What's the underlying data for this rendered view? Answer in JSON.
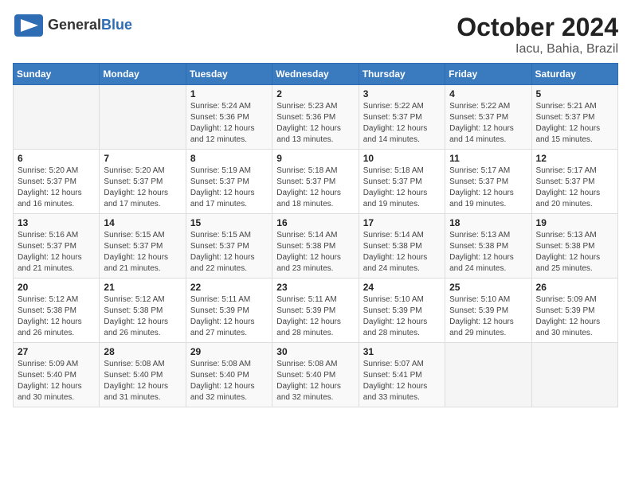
{
  "header": {
    "logo": {
      "general": "General",
      "blue": "Blue",
      "icon": "▶"
    },
    "title": "October 2024",
    "subtitle": "Iacu, Bahia, Brazil"
  },
  "calendar": {
    "days_of_week": [
      "Sunday",
      "Monday",
      "Tuesday",
      "Wednesday",
      "Thursday",
      "Friday",
      "Saturday"
    ],
    "weeks": [
      [
        {
          "day": "",
          "empty": true
        },
        {
          "day": "",
          "empty": true
        },
        {
          "day": "1",
          "sunrise": "5:24 AM",
          "sunset": "5:36 PM",
          "daylight": "12 hours and 12 minutes."
        },
        {
          "day": "2",
          "sunrise": "5:23 AM",
          "sunset": "5:36 PM",
          "daylight": "12 hours and 13 minutes."
        },
        {
          "day": "3",
          "sunrise": "5:22 AM",
          "sunset": "5:37 PM",
          "daylight": "12 hours and 14 minutes."
        },
        {
          "day": "4",
          "sunrise": "5:22 AM",
          "sunset": "5:37 PM",
          "daylight": "12 hours and 14 minutes."
        },
        {
          "day": "5",
          "sunrise": "5:21 AM",
          "sunset": "5:37 PM",
          "daylight": "12 hours and 15 minutes."
        }
      ],
      [
        {
          "day": "6",
          "sunrise": "5:20 AM",
          "sunset": "5:37 PM",
          "daylight": "12 hours and 16 minutes."
        },
        {
          "day": "7",
          "sunrise": "5:20 AM",
          "sunset": "5:37 PM",
          "daylight": "12 hours and 17 minutes."
        },
        {
          "day": "8",
          "sunrise": "5:19 AM",
          "sunset": "5:37 PM",
          "daylight": "12 hours and 17 minutes."
        },
        {
          "day": "9",
          "sunrise": "5:18 AM",
          "sunset": "5:37 PM",
          "daylight": "12 hours and 18 minutes."
        },
        {
          "day": "10",
          "sunrise": "5:18 AM",
          "sunset": "5:37 PM",
          "daylight": "12 hours and 19 minutes."
        },
        {
          "day": "11",
          "sunrise": "5:17 AM",
          "sunset": "5:37 PM",
          "daylight": "12 hours and 19 minutes."
        },
        {
          "day": "12",
          "sunrise": "5:17 AM",
          "sunset": "5:37 PM",
          "daylight": "12 hours and 20 minutes."
        }
      ],
      [
        {
          "day": "13",
          "sunrise": "5:16 AM",
          "sunset": "5:37 PM",
          "daylight": "12 hours and 21 minutes."
        },
        {
          "day": "14",
          "sunrise": "5:15 AM",
          "sunset": "5:37 PM",
          "daylight": "12 hours and 21 minutes."
        },
        {
          "day": "15",
          "sunrise": "5:15 AM",
          "sunset": "5:37 PM",
          "daylight": "12 hours and 22 minutes."
        },
        {
          "day": "16",
          "sunrise": "5:14 AM",
          "sunset": "5:38 PM",
          "daylight": "12 hours and 23 minutes."
        },
        {
          "day": "17",
          "sunrise": "5:14 AM",
          "sunset": "5:38 PM",
          "daylight": "12 hours and 24 minutes."
        },
        {
          "day": "18",
          "sunrise": "5:13 AM",
          "sunset": "5:38 PM",
          "daylight": "12 hours and 24 minutes."
        },
        {
          "day": "19",
          "sunrise": "5:13 AM",
          "sunset": "5:38 PM",
          "daylight": "12 hours and 25 minutes."
        }
      ],
      [
        {
          "day": "20",
          "sunrise": "5:12 AM",
          "sunset": "5:38 PM",
          "daylight": "12 hours and 26 minutes."
        },
        {
          "day": "21",
          "sunrise": "5:12 AM",
          "sunset": "5:38 PM",
          "daylight": "12 hours and 26 minutes."
        },
        {
          "day": "22",
          "sunrise": "5:11 AM",
          "sunset": "5:39 PM",
          "daylight": "12 hours and 27 minutes."
        },
        {
          "day": "23",
          "sunrise": "5:11 AM",
          "sunset": "5:39 PM",
          "daylight": "12 hours and 28 minutes."
        },
        {
          "day": "24",
          "sunrise": "5:10 AM",
          "sunset": "5:39 PM",
          "daylight": "12 hours and 28 minutes."
        },
        {
          "day": "25",
          "sunrise": "5:10 AM",
          "sunset": "5:39 PM",
          "daylight": "12 hours and 29 minutes."
        },
        {
          "day": "26",
          "sunrise": "5:09 AM",
          "sunset": "5:39 PM",
          "daylight": "12 hours and 30 minutes."
        }
      ],
      [
        {
          "day": "27",
          "sunrise": "5:09 AM",
          "sunset": "5:40 PM",
          "daylight": "12 hours and 30 minutes."
        },
        {
          "day": "28",
          "sunrise": "5:08 AM",
          "sunset": "5:40 PM",
          "daylight": "12 hours and 31 minutes."
        },
        {
          "day": "29",
          "sunrise": "5:08 AM",
          "sunset": "5:40 PM",
          "daylight": "12 hours and 32 minutes."
        },
        {
          "day": "30",
          "sunrise": "5:08 AM",
          "sunset": "5:40 PM",
          "daylight": "12 hours and 32 minutes."
        },
        {
          "day": "31",
          "sunrise": "5:07 AM",
          "sunset": "5:41 PM",
          "daylight": "12 hours and 33 minutes."
        },
        {
          "day": "",
          "empty": true
        },
        {
          "day": "",
          "empty": true
        }
      ]
    ]
  }
}
